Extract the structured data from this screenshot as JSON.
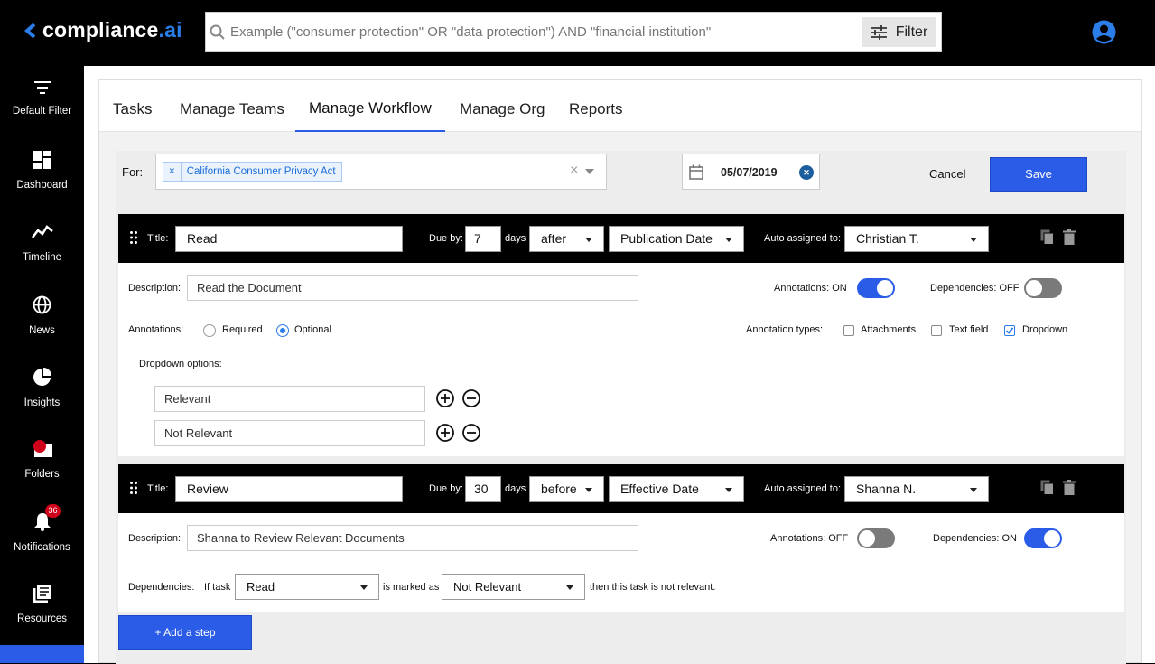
{
  "app": {
    "logo_main": "compliance",
    "logo_ai": ".ai"
  },
  "search": {
    "placeholder": "Example (\"consumer protection\" OR \"data protection\") AND \"financial institution\"",
    "filter_label": "Filter"
  },
  "sidebar": {
    "items": [
      {
        "label": "Default Filter",
        "icon": "filter-icon"
      },
      {
        "label": "Dashboard",
        "icon": "dashboard-icon"
      },
      {
        "label": "Timeline",
        "icon": "timeline-icon"
      },
      {
        "label": "News",
        "icon": "globe-icon"
      },
      {
        "label": "Insights",
        "icon": "pie-chart-icon"
      },
      {
        "label": "Folders",
        "icon": "folder-icon"
      },
      {
        "label": "Notifications",
        "icon": "bell-icon",
        "badge": "36"
      },
      {
        "label": "Resources",
        "icon": "library-icon"
      }
    ]
  },
  "tabs": [
    "Tasks",
    "Manage Teams",
    "Manage Workflow",
    "Manage Org",
    "Reports"
  ],
  "active_tab": "Manage Workflow",
  "workflow": {
    "for_label": "For:",
    "for_tag": "California Consumer Privacy Act",
    "date": "05/07/2019",
    "cancel": "Cancel",
    "save": "Save",
    "add_step": "+ Add a step"
  },
  "labels": {
    "title": "Title:",
    "due_by": "Due by:",
    "days": "days",
    "auto_assigned": "Auto assigned to:",
    "description": "Description:",
    "annotations": "Annotations:",
    "required": "Required",
    "optional": "Optional",
    "annotation_types": "Annotation types:",
    "attachments": "Attachments",
    "text_field": "Text field",
    "dropdown": "Dropdown",
    "dropdown_options": "Dropdown options:",
    "dependencies": "Dependencies:",
    "if_task": "If task",
    "is_marked_as": "is marked as",
    "then_text": "then this task is not relevant."
  },
  "steps": [
    {
      "title": "Read",
      "due_days": "7",
      "relation": "after",
      "event": "Publication Date",
      "assignee": "Christian T.",
      "description": "Read the Document",
      "annotations_label": "Annotations: ON",
      "dependencies_label": "Dependencies: OFF",
      "annotations_on": true,
      "dependencies_on": false,
      "annotation_mode": "Optional",
      "types": {
        "attachments": false,
        "text_field": false,
        "dropdown": true
      },
      "dropdown_options": [
        "Relevant",
        "Not Relevant"
      ]
    },
    {
      "title": "Review",
      "due_days": "30",
      "relation": "before",
      "event": "Effective Date",
      "assignee": "Shanna N.",
      "description": "Shanna to Review Relevant Documents",
      "annotations_label": "Annotations: OFF",
      "dependencies_label": "Dependencies: ON",
      "annotations_on": false,
      "dependencies_on": true,
      "dependency_task": "Read",
      "dependency_value": "Not Relevant"
    }
  ],
  "colors": {
    "accent": "#2b5ce7",
    "toggle_off": "#7a7a7a",
    "header_bg": "#000000"
  }
}
